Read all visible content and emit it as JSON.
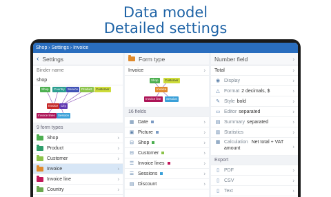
{
  "headline": {
    "line1": "Data model",
    "line2": "Detailed settings"
  },
  "titlebar": {
    "path": "Shop › Settings › Invoice"
  },
  "col1": {
    "title": "Settings",
    "binder_label": "Binder name",
    "binder_value": "shop",
    "diagram_nodes": [
      "Shop",
      "Country",
      "Service",
      "Product",
      "Customer",
      "Invoice",
      "City",
      "Invoice lines",
      "Session"
    ],
    "types_header": "9 form types",
    "items": [
      {
        "label": "Shop",
        "color": "#4caf50"
      },
      {
        "label": "Product",
        "color": "#2e9e6b"
      },
      {
        "label": "Customer",
        "color": "#8bc34a"
      },
      {
        "label": "Invoice",
        "color": "#e08a2c"
      },
      {
        "label": "Invoice line",
        "color": "#c2185b"
      },
      {
        "label": "Country",
        "color": "#6aa84f"
      }
    ]
  },
  "col2": {
    "title": "Form type",
    "form_name": "Invoice",
    "diagram_nodes": [
      "Shop",
      "Customer",
      "Invoice",
      "Invoice line",
      "Session"
    ],
    "fields_header": "16 fields",
    "fields": [
      {
        "label": "Date",
        "icon": "calendar-icon",
        "color": "#7b9bc4"
      },
      {
        "label": "Picture",
        "icon": "image-icon",
        "color": "#7b9bc4"
      },
      {
        "label": "Shop",
        "icon": "link-icon",
        "color": "#4caf50"
      },
      {
        "label": "Customer",
        "icon": "link-icon",
        "color": "#8bc34a"
      },
      {
        "label": "Invoice lines",
        "icon": "list-icon",
        "color": "#c2185b"
      },
      {
        "label": "Sessions",
        "icon": "list-icon",
        "color": "#3aa0d8"
      },
      {
        "label": "Discount",
        "icon": "number-icon",
        "color": ""
      }
    ]
  },
  "col3": {
    "title": "Number field",
    "field_name": "Total",
    "display": "Display",
    "format_label": "Format",
    "format_value": "2 decimals, $",
    "style_label": "Style",
    "style_value": "bold",
    "editor_label": "Editor",
    "editor_value": "separated",
    "summary_label": "Summary",
    "summary_value": "separated",
    "statistics": "Statistics",
    "calc_label": "Calculation",
    "calc_value": "Net total + VAT amount",
    "export_header": "Export",
    "export_items": [
      "PDF",
      "CSV",
      "Text"
    ]
  }
}
